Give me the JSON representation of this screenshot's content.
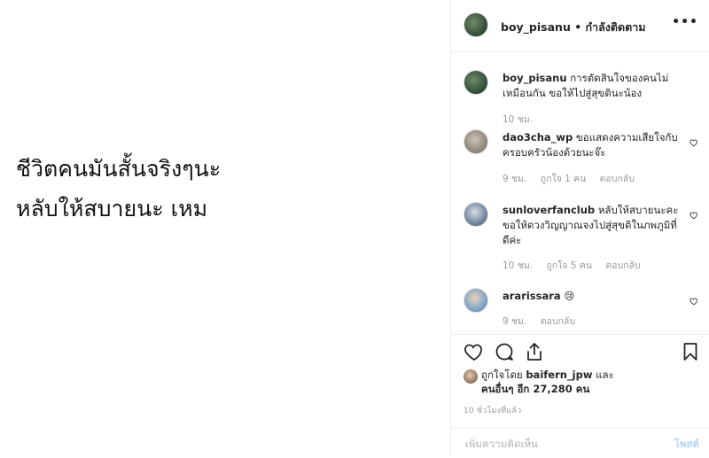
{
  "post": {
    "text": "ชีวิตคนมันสั้นจริงๆนะ\nหลับให้สบายนะ เหม"
  },
  "header": {
    "username": "boy_pisanu",
    "separator": " • ",
    "follow_label": "กำลังติดตาม",
    "more_label": "•••"
  },
  "comments": [
    {
      "username": "boy_pisanu",
      "text": "การตัดสินใจของคนไม่เหมือนกัน ขอให้ไปสู่สุขตินะน้อง",
      "time": "10 ชม.",
      "likes": "",
      "reply": ""
    },
    {
      "username": "dao3cha_wp",
      "text": "ขอแสดงความเสียใจกับครอบครัวน้องด้วยนะจ๊ะ",
      "time": "9 ชม.",
      "likes": "ถูกใจ 1 คน",
      "reply": "ตอบกลับ"
    },
    {
      "username": "sunloverfanclub",
      "text": "หลับให้สบายนะคะ ขอให้ดวงวิญญาณจงไปสู่สุขติในภพภูมิที่ดีค่ะ",
      "time": "10 ชม.",
      "likes": "ถูกใจ 5 คน",
      "reply": "ตอบกลับ"
    },
    {
      "username": "ararissara",
      "text": "😢",
      "time": "9 ชม.",
      "likes": "",
      "reply": "ตอบกลับ"
    }
  ],
  "likes": {
    "prefix": "ถูกใจโดย",
    "liker": "baifern_jpw",
    "connector": "และ",
    "others": "คนอื่นๆ อีก 27,280 คน"
  },
  "time_ago": "10 ชั่วโมงที่แล้ว",
  "add_comment": {
    "placeholder": "เพิ่มความคิดเห็น",
    "post_label": "โพสต์"
  },
  "colors": {
    "accent_disabled": "#b3d4f5",
    "muted": "#999999",
    "border": "#efefef"
  },
  "icons": [
    "heart-icon",
    "comment-icon",
    "share-icon",
    "bookmark-icon",
    "more-icon"
  ]
}
